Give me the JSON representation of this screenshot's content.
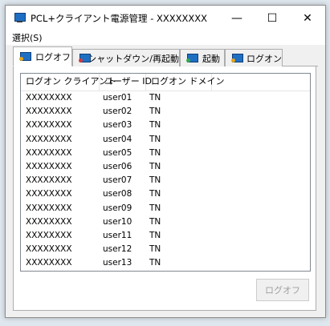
{
  "window": {
    "title": "PCL+クライアント電源管理 - XXXXXXXX",
    "minimize_glyph": "—",
    "maximize_glyph": "☐",
    "close_glyph": "✕"
  },
  "menu": {
    "items": [
      "選択(S)"
    ]
  },
  "tabs": [
    {
      "label": "ログオフ",
      "icon": "monitor-logoff-icon",
      "active": true
    },
    {
      "label": "シャットダウン/再起動",
      "icon": "monitor-shutdown-icon",
      "active": false
    },
    {
      "label": "起動",
      "icon": "monitor-start-icon",
      "active": false
    },
    {
      "label": "ログオン",
      "icon": "monitor-logon-icon",
      "active": false
    }
  ],
  "table": {
    "headers": [
      "ログオン クライアント",
      "ユーザー ID",
      "ログオン ドメイン"
    ],
    "rows": [
      [
        "XXXXXXXX",
        "user01",
        "TN"
      ],
      [
        "XXXXXXXX",
        "user02",
        "TN"
      ],
      [
        "XXXXXXXX",
        "user03",
        "TN"
      ],
      [
        "XXXXXXXX",
        "user04",
        "TN"
      ],
      [
        "XXXXXXXX",
        "user05",
        "TN"
      ],
      [
        "XXXXXXXX",
        "user06",
        "TN"
      ],
      [
        "XXXXXXXX",
        "user07",
        "TN"
      ],
      [
        "XXXXXXXX",
        "user08",
        "TN"
      ],
      [
        "XXXXXXXX",
        "user09",
        "TN"
      ],
      [
        "XXXXXXXX",
        "user10",
        "TN"
      ],
      [
        "XXXXXXXX",
        "user11",
        "TN"
      ],
      [
        "XXXXXXXX",
        "user12",
        "TN"
      ],
      [
        "XXXXXXXX",
        "user13",
        "TN"
      ]
    ]
  },
  "action_button": {
    "label": "ログオフ",
    "enabled": false
  },
  "colors": {
    "accent": "#1e6fc2",
    "disabled_text": "#a0a0a0"
  }
}
